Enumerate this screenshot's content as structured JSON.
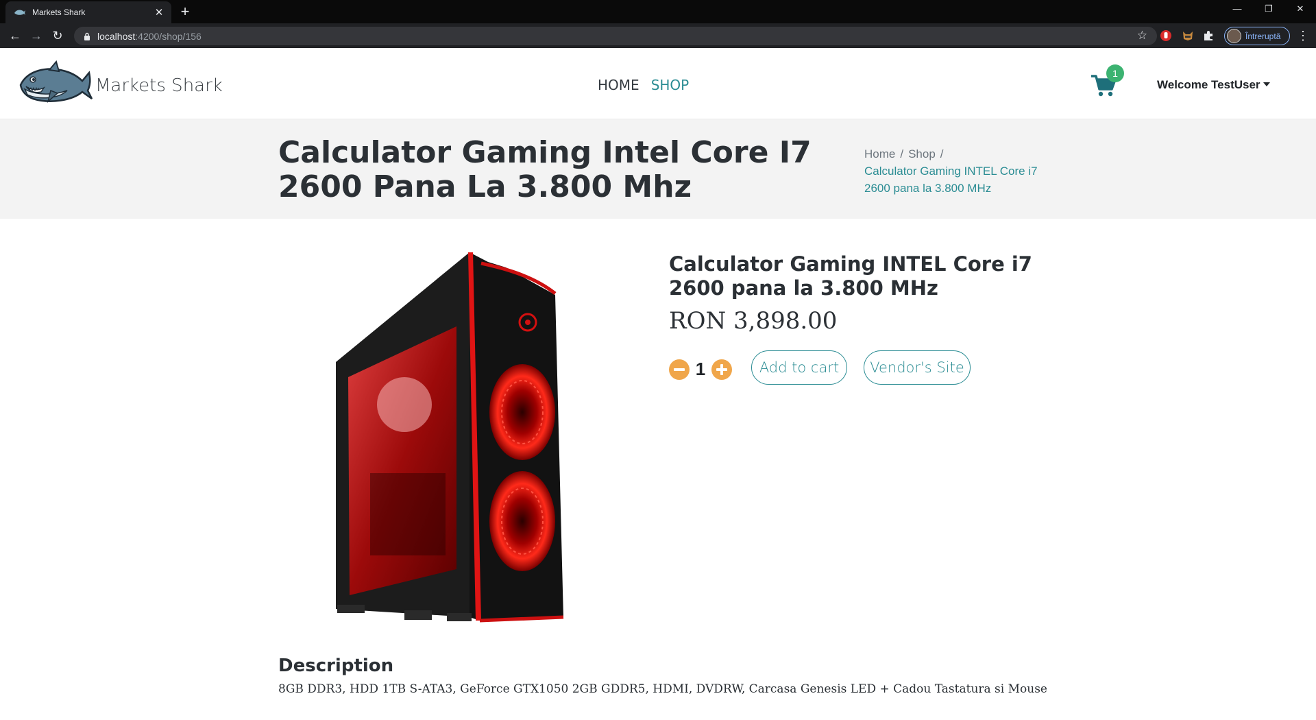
{
  "browser": {
    "tab_title": "Markets Shark",
    "url_host": "localhost",
    "url_rest": ":4200/shop/156",
    "profile_label": "Întreruptă"
  },
  "header": {
    "brand": "Markets Shark",
    "nav": {
      "home": "HOME",
      "shop": "SHOP"
    },
    "cart_count": "1",
    "user_label": "Welcome TestUser"
  },
  "banner": {
    "title": "Calculator Gaming Intel Core I7 2600 Pana La 3.800 Mhz",
    "breadcrumb": {
      "home": "Home",
      "shop": "Shop",
      "sep": "/",
      "current": "Calculator Gaming INTEL Core i7 2600 pana la 3.800 MHz"
    }
  },
  "product": {
    "name": "Calculator Gaming INTEL Core i7 2600 pana la 3.800 MHz",
    "price": "RON 3,898.00",
    "quantity": "1",
    "add_to_cart_label": "Add to cart",
    "vendor_label": "Vendor's Site",
    "description_title": "Description",
    "description": "8GB DDR3, HDD 1TB S-ATA3, GeForce GTX1050 2GB GDDR5, HDMI, DVDRW, Carcasa Genesis LED + Cadou Tastatura si Mouse"
  },
  "colors": {
    "accent": "#2a8c93",
    "qty_buttons": "#f0a64a",
    "cart_badge": "#3cb371",
    "banner_bg": "#f3f3f3"
  }
}
